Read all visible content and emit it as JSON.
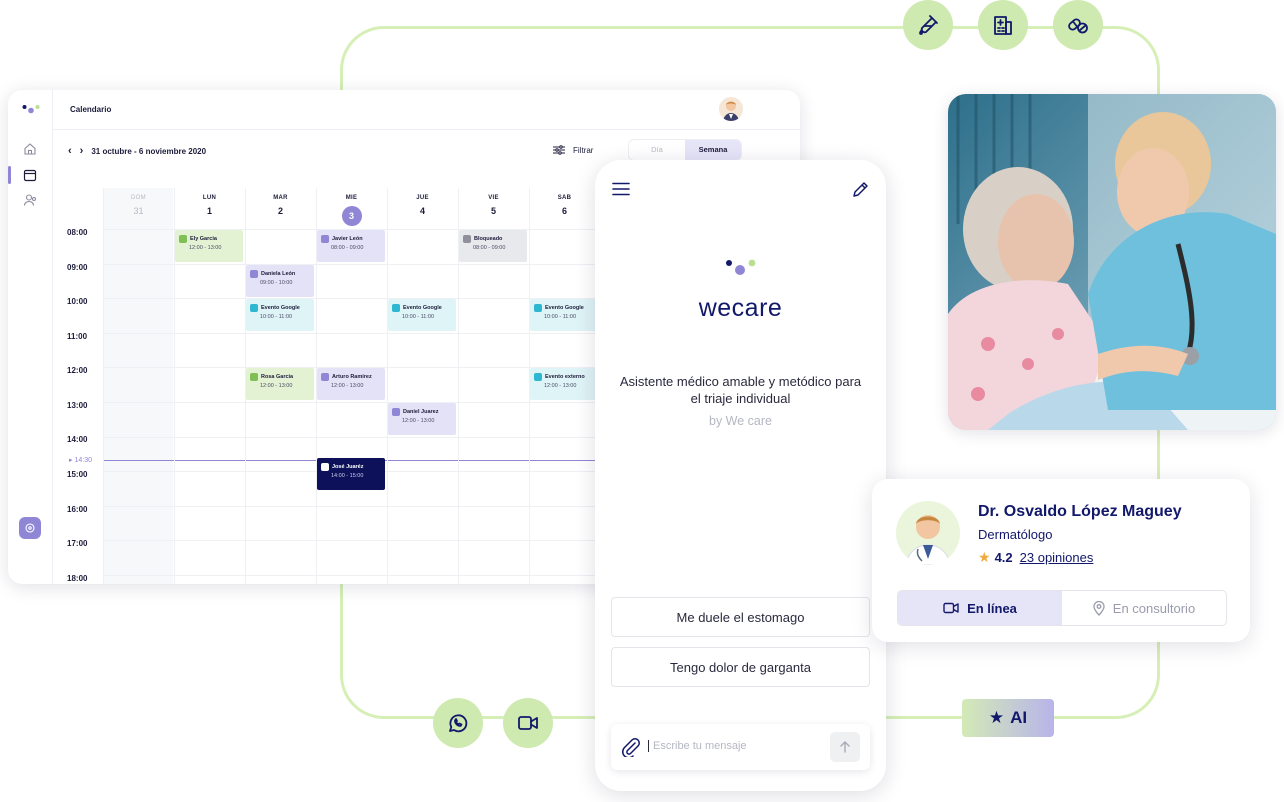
{
  "colors": {
    "frame": "#d6efb6",
    "circle": "#cfeab0",
    "accent": "#8f86d6",
    "brand_navy": "#12186a",
    "event_green": "#e3f2d2",
    "event_purple": "#e4e2f6",
    "event_cyan": "#dff4f7",
    "event_gray": "#e8e9ed",
    "event_navy": "#0c1159"
  },
  "feature_icons": [
    "test-tube-icon",
    "hospital-icon",
    "pills-icon",
    "whatsapp-icon",
    "video-icon"
  ],
  "calendar": {
    "title": "Calendario",
    "range": "31 octubre - 6 noviembre 2020",
    "prev": "‹",
    "next": "›",
    "filter": "Filtrar",
    "views": [
      "Día",
      "Semana"
    ],
    "selected_view": "Semana",
    "days": [
      {
        "name": "DOM",
        "date": "31"
      },
      {
        "name": "LUN",
        "date": "1"
      },
      {
        "name": "MAR",
        "date": "2"
      },
      {
        "name": "MIE",
        "date": "3"
      },
      {
        "name": "JUE",
        "date": "4"
      },
      {
        "name": "VIE",
        "date": "5"
      },
      {
        "name": "SAB",
        "date": "6"
      }
    ],
    "today_index": 3,
    "hours": [
      "08:00",
      "09:00",
      "10:00",
      "11:00",
      "12:00",
      "13:00",
      "14:00",
      "15:00",
      "16:00",
      "17:00",
      "18:00"
    ],
    "now_label": "14:30",
    "events": [
      {
        "title": "Ely Garcia",
        "time": "12:00 - 13:00",
        "color": "green",
        "day": 1,
        "start": 8
      },
      {
        "title": "Javier León",
        "time": "08:00 - 09:00",
        "color": "purple",
        "day": 3,
        "start": 8
      },
      {
        "title": "Bloqueado",
        "time": "08:00 - 09:00",
        "color": "gray",
        "day": 5,
        "start": 8
      },
      {
        "title": "Daniela León",
        "time": "09:00 - 10:00",
        "color": "purple",
        "day": 2,
        "start": 9
      },
      {
        "title": "Evento Google",
        "time": "10:00 - 11:00",
        "color": "cyan",
        "day": 2,
        "start": 10
      },
      {
        "title": "Evento Google",
        "time": "10:00 - 11:00",
        "color": "cyan",
        "day": 4,
        "start": 10
      },
      {
        "title": "Evento Google",
        "time": "10:00 - 11:00",
        "color": "cyan",
        "day": 6,
        "start": 10
      },
      {
        "title": "Rosa Garcia",
        "time": "12:00 - 13:00",
        "color": "green",
        "day": 2,
        "start": 12
      },
      {
        "title": "Arturo Ramirez",
        "time": "12:00 - 13:00",
        "color": "purple",
        "day": 3,
        "start": 12
      },
      {
        "title": "Evento externo",
        "time": "12:00 - 13:00",
        "color": "cyan",
        "day": 6,
        "start": 12
      },
      {
        "title": "Daniel Juarez",
        "time": "12:00 - 13:00",
        "color": "purple",
        "day": 4,
        "start": 13
      },
      {
        "title": "José Juaréz",
        "time": "14:00 - 15:00",
        "color": "navy",
        "day": 3,
        "start": 14.6
      }
    ]
  },
  "chat": {
    "brand": "wecare",
    "tagline": "Asistente médico amable y metódico para el triaje individual",
    "by": "by We care",
    "suggestions": [
      "Me duele el estomago",
      "Tengo dolor de garganta"
    ],
    "input_placeholder": "Escribe tu mensaje"
  },
  "doctor": {
    "name": "Dr. Osvaldo López Maguey",
    "specialty": "Dermatólogo",
    "rating": "4.2",
    "reviews": "23 opiniones",
    "tabs": [
      "En línea",
      "En consultorio"
    ],
    "selected_tab": "En línea"
  },
  "ai_badge": "AI"
}
